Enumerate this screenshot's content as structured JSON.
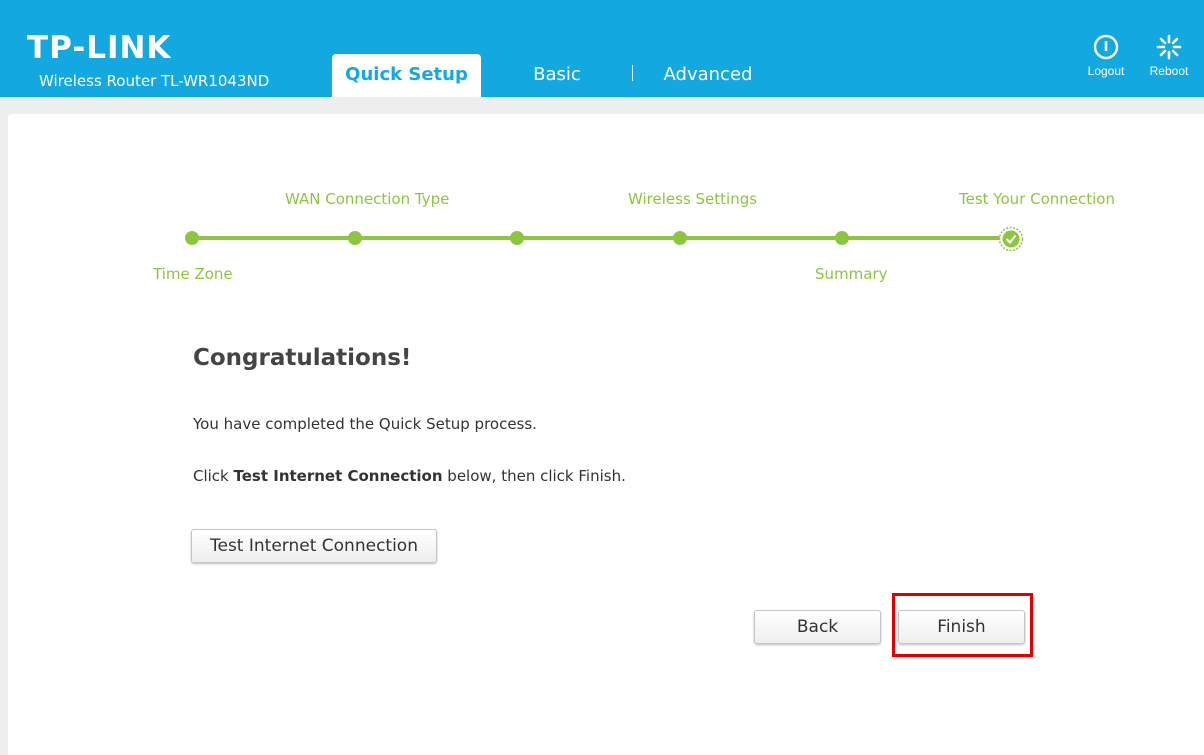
{
  "header": {
    "logo": "TP-LINK",
    "model": "Wireless Router TL-WR1043ND",
    "tabs": [
      "Quick Setup",
      "Basic",
      "Advanced"
    ],
    "logout": "Logout",
    "reboot": "Reboot"
  },
  "progress": {
    "steps_top": [
      "WAN Connection Type",
      "Wireless Settings",
      "Test Your Connection"
    ],
    "steps_bottom": [
      "Time Zone",
      "Summary"
    ],
    "accent_color": "#8cc63f"
  },
  "main": {
    "title": "Congratulations!",
    "line1": "You have completed the Quick Setup process.",
    "line2_prefix": "Click ",
    "line2_bold": "Test Internet Connection",
    "line2_suffix": " below, then click Finish.",
    "test_button": "Test Internet Connection",
    "back_button": "Back",
    "finish_button": "Finish"
  },
  "colors": {
    "brand": "#13a9e0",
    "highlight": "#e00000"
  }
}
